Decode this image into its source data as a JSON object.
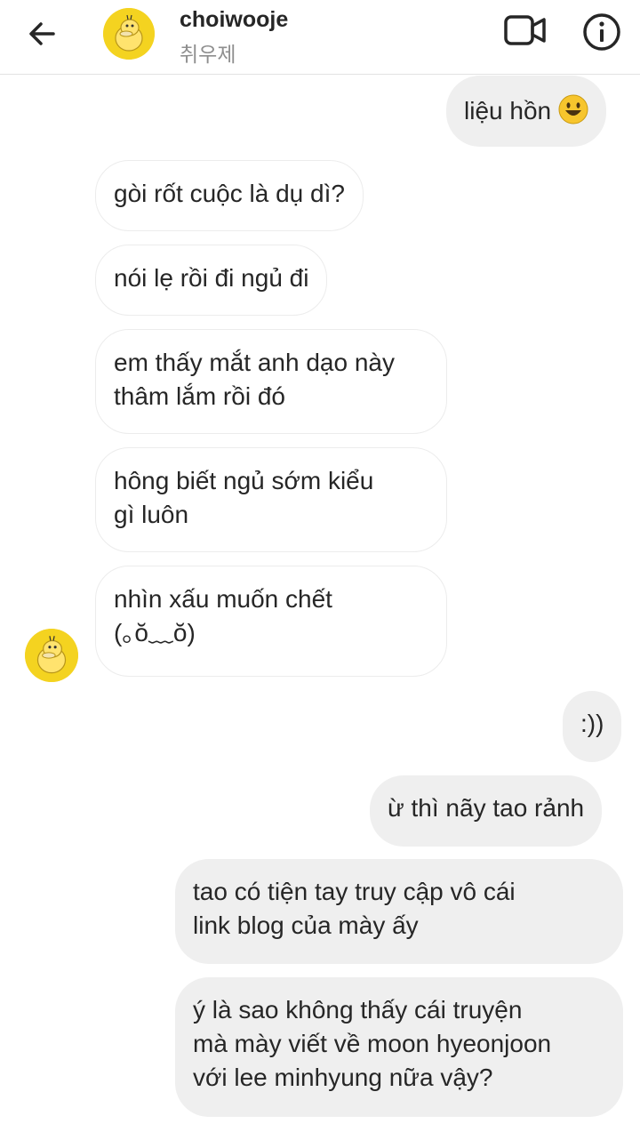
{
  "header": {
    "username": "choiwooje",
    "subname": "취우제",
    "back_icon": "arrow-left-icon",
    "video_icon": "video-camera-icon",
    "info_icon": "info-icon"
  },
  "messages": [
    {
      "direction": "out",
      "text": "liệu hồn",
      "emoji": "😃"
    },
    {
      "direction": "in",
      "text": "gòi rốt cuộc là dụ dì?"
    },
    {
      "direction": "in",
      "text": "nói lẹ rồi đi ngủ đi"
    },
    {
      "direction": "in",
      "line1": "em thấy mắt anh dạo này",
      "line2": "thâm lắm rồi đó"
    },
    {
      "direction": "in",
      "line1": "hông biết ngủ sớm kiểu",
      "line2": "gì luôn"
    },
    {
      "direction": "in",
      "line1": "nhìn xấu muốn chết",
      "line2": "(｡ŏ﹏ŏ)"
    },
    {
      "direction": "out",
      "text": ":))"
    },
    {
      "direction": "out",
      "text": "ừ thì nãy tao rảnh"
    },
    {
      "direction": "out",
      "line1": "tao có tiện tay truy cập vô cái",
      "line2": "link blog của mày ấy"
    },
    {
      "direction": "out",
      "line1": "ý là sao không thấy cái truyện",
      "line2": "mà mày viết về moon hyeonjoon",
      "line3": "với lee minhyung nữa vậy?"
    }
  ],
  "colors": {
    "incoming_bg": "#ffffff",
    "outgoing_bg": "#efefef",
    "avatar_yellow": "#f4d320",
    "secondary_text": "#8e8e8e"
  }
}
